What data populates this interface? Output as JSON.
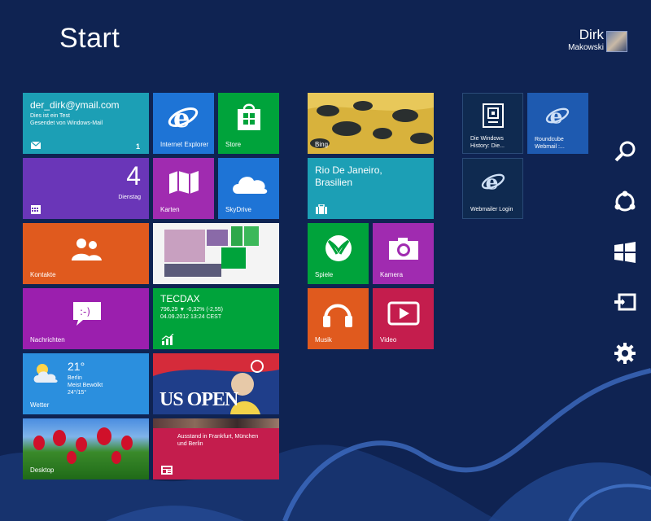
{
  "screen_title": "Start",
  "user": {
    "first_name": "Dirk",
    "last_name": "Makowski"
  },
  "mail": {
    "address": "der_dirk@ymail.com",
    "subject": "Dies ist ein Test",
    "body": "Gesendet von Windows-Mail",
    "count": "1"
  },
  "calendar": {
    "day": "4",
    "weekday": "Dienstag"
  },
  "tiles": {
    "ie": "Internet Explorer",
    "store": "Store",
    "karten": "Karten",
    "skydrive": "SkyDrive",
    "kontakte": "Kontakte",
    "nachrichten": "Nachrichten",
    "bing": "Bing",
    "spiele": "Spiele",
    "kamera": "Kamera",
    "musik": "Musik",
    "video": "Video",
    "desktop": "Desktop",
    "windows_history": "Die Windows History: Die...",
    "roundcube": "Roundcube Webmail :...",
    "webmailer": "Webmailer Login"
  },
  "finance": {
    "index": "TECDAX",
    "quote": "796,29  ▼ -0,32% (-2,55)",
    "datetime": "04.09.2012 13:24 CEST"
  },
  "weather": {
    "temp": "21°",
    "city": "Berlin",
    "condition": "Meist Bewölkt",
    "range": "24°/15°",
    "label": "Wetter"
  },
  "travel": {
    "destination": "Rio De Janeiro, Brasilien"
  },
  "sport": {
    "headline": "US OPEN"
  },
  "news": {
    "headline": "Ausstand in Frankfurt, München und Berlin"
  },
  "colors": {
    "background": "#0f2352",
    "mail": "#1c9fb5",
    "ie": "#1e74d6",
    "store": "#00a33b",
    "calendar": "#6a36b8",
    "karten": "#a02bb0",
    "skydrive": "#1e74d6",
    "kontakte": "#e05a1e",
    "nachrichten": "#9b1fae",
    "finance": "#00a33b",
    "weather": "#2b8fde",
    "travel": "#1c9fb5",
    "spiele": "#00a33b",
    "kamera": "#a02bb0",
    "musik": "#e05a1e",
    "video": "#c41d4d",
    "news": "#c41d4d"
  },
  "icons": [
    "mail-icon",
    "calendar-icon",
    "ie-icon",
    "store-icon",
    "maps-icon",
    "cloud-icon",
    "people-icon",
    "messaging-icon",
    "finance-chart-icon",
    "suitcase-icon",
    "xbox-controller-icon",
    "camera-icon",
    "headphones-icon",
    "play-icon",
    "newspaper-icon",
    "search-icon",
    "share-icon",
    "windows-start-icon",
    "devices-icon",
    "settings-gear-icon"
  ]
}
